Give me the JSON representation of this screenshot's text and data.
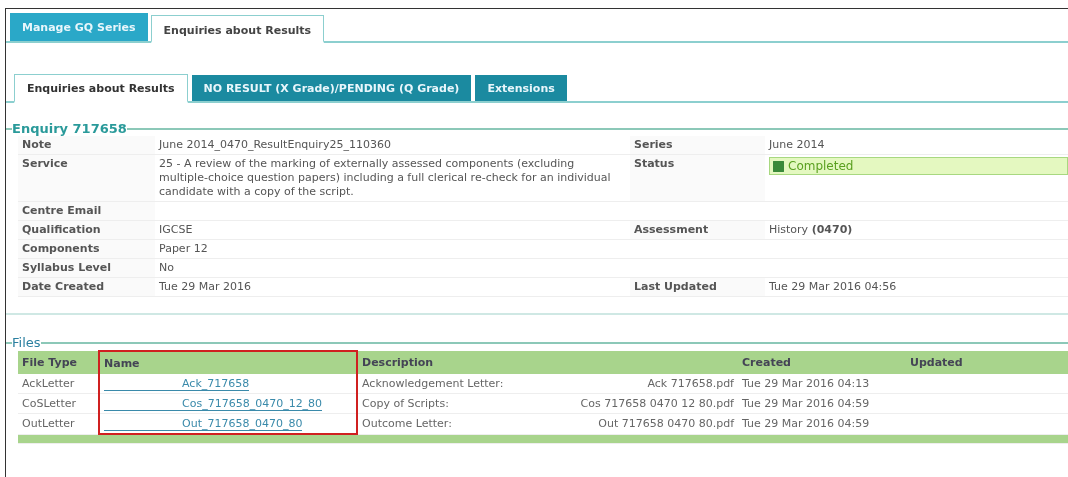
{
  "top_tabs": [
    {
      "label": "Manage GQ Series",
      "selected": false
    },
    {
      "label": "Enquiries about Results",
      "selected": true
    }
  ],
  "sub_tabs": [
    {
      "label": "Enquiries about Results",
      "selected": true
    },
    {
      "label": "NO RESULT (X Grade)/PENDING (Q Grade)",
      "selected": false
    },
    {
      "label": "Extensions",
      "selected": false
    }
  ],
  "enquiry": {
    "title": "Enquiry 717658",
    "rows": [
      {
        "label": "Note",
        "value": "June 2014_0470_ResultEnquiry25_110360",
        "label_2": "Series",
        "value_2": "June 2014"
      },
      {
        "label": "Service",
        "value": "25 - A review of the marking of externally assessed components (excluding multiple-choice question papers) including a full clerical re-check for an individual candidate with a copy of the script.",
        "label_2": "Status",
        "status": {
          "text": "Completed",
          "checked": true
        }
      },
      {
        "label": "Centre Email"
      },
      {
        "label": "Qualification",
        "value": "IGCSE",
        "label_2": "Assessment",
        "value_2": "History **(0470)**"
      },
      {
        "label": "Components",
        "value": "Paper 12"
      },
      {
        "label": "Syllabus Level",
        "value": "No"
      },
      {
        "label": "Date Created",
        "value": "Tue 29 Mar 2016",
        "label_2": "Last Updated",
        "value_2": "Tue 29 Mar 2016 04:56"
      }
    ]
  },
  "files": {
    "title": "Files",
    "columns": [
      {
        "label": "File Type",
        "highlighted": false
      },
      {
        "label": "Name",
        "highlighted": true
      },
      {
        "label": "Description",
        "highlighted": false
      },
      {
        "label": "Created",
        "highlighted": false
      },
      {
        "label": "Updated",
        "highlighted": false
      }
    ],
    "rows": [
      {
        "file_type": "AckLetter",
        "name": "Ack_717658",
        "description": "Acknowledgement Letter:",
        "file": "Ack 717658.pdf",
        "created": "Tue 29 Mar 2016 04:13"
      },
      {
        "file_type": "CoSLetter",
        "name": "Cos_717658_0470_12_80",
        "description": "Copy of Scripts:",
        "file": "Cos 717658 0470 12 80.pdf",
        "created": "Tue 29 Mar 2016 04:59"
      },
      {
        "file_type": "OutLetter",
        "name": "Out_717658_0470_80",
        "description": "Outcome Letter:",
        "file": "Out 717658 0470 80.pdf",
        "created": "Tue 29 Mar 2016 04:59"
      }
    ]
  }
}
